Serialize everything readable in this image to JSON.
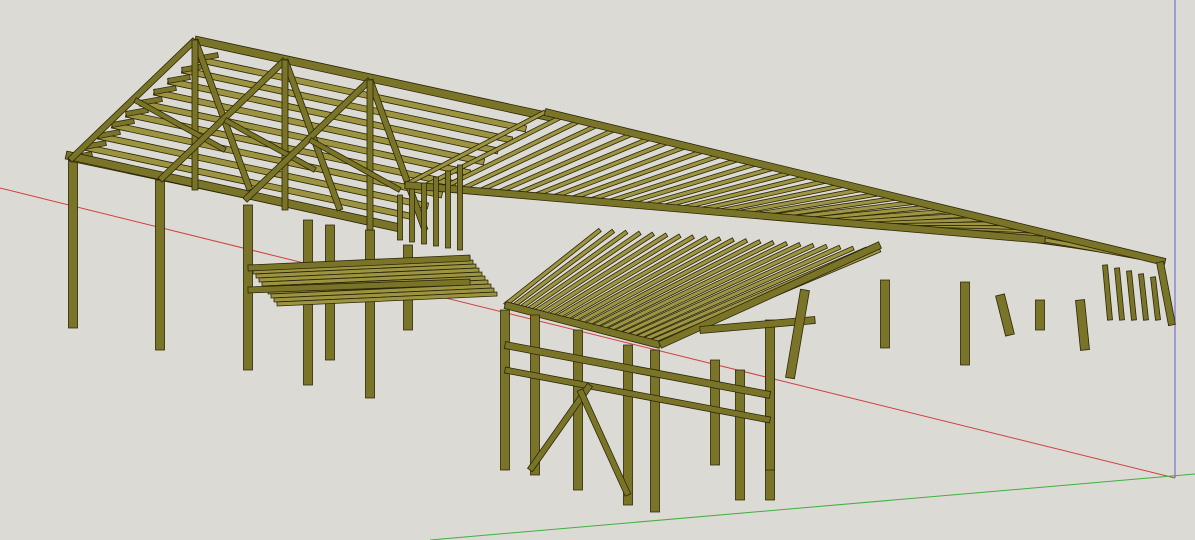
{
  "app": {
    "viewport_label": "",
    "background_color": "#dcdad4"
  },
  "axes": {
    "red_axis_color": "#d04040",
    "green_axis_color": "#40b040",
    "blue_axis_color": "#6060d0"
  },
  "model": {
    "timber_fill": "#7a7428",
    "timber_light": "#9c9440",
    "timber_edge": "#2a2608"
  }
}
